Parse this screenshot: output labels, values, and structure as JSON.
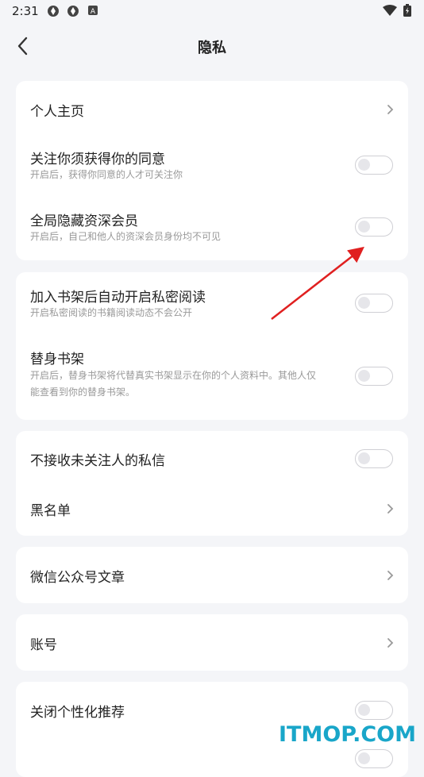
{
  "status": {
    "time": "2:31"
  },
  "header": {
    "title": "隐私"
  },
  "group1": {
    "homepage": "个人主页",
    "follow_consent": {
      "title": "关注你须获得你的同意",
      "sub": "开启后，获得你同意的人才可关注你",
      "on": false
    },
    "hide_member": {
      "title": "全局隐藏资深会员",
      "sub": "开启后，自己和他人的资深会员身份均不可见",
      "on": false
    }
  },
  "group2": {
    "private_read": {
      "title": "加入书架后自动开启私密阅读",
      "sub": "开启私密阅读的书籍阅读动态不会公开",
      "on": false
    },
    "alt_shelf": {
      "title": "替身书架",
      "sub1": "开启后，替身书架将代替真实书架显示在你的个人资料中。其他人仅",
      "sub2": "能查看到你的替身书架。",
      "on": false
    }
  },
  "group3": {
    "no_dm": {
      "title": "不接收未关注人的私信",
      "on": false
    },
    "blacklist": "黑名单"
  },
  "group4": {
    "wechat": "微信公众号文章"
  },
  "group5": {
    "account": "账号"
  },
  "group6": {
    "personalization": {
      "title": "关闭个性化推荐",
      "on": false
    }
  },
  "watermark": "ITMOP.COM",
  "colors": {
    "background": "#f4f5f8",
    "card": "#ffffff",
    "arrow": "#e02020",
    "watermark": "#19a6c9"
  }
}
